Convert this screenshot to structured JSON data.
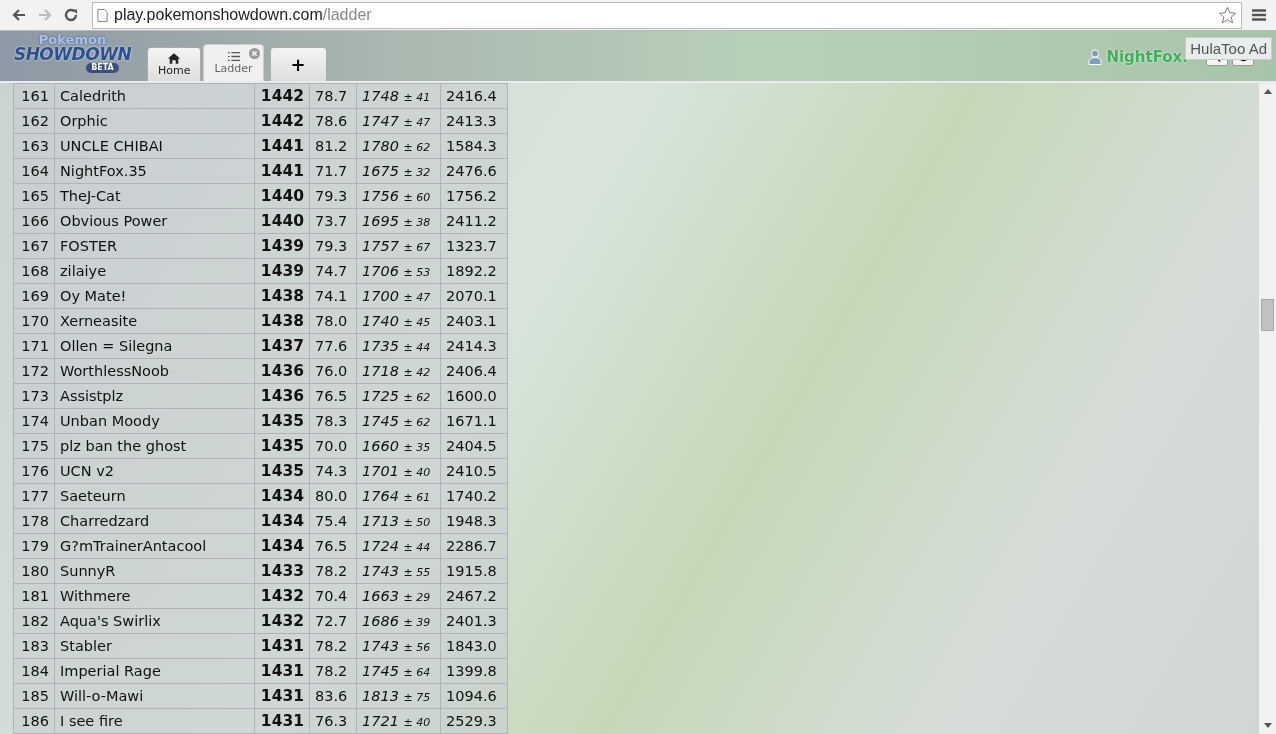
{
  "browser": {
    "url_host": "play.pokemonshowdown.com",
    "url_path": "/ladder"
  },
  "header": {
    "logo": {
      "top": "Pokémon",
      "main": "SHOWDOWN",
      "badge": "BETA"
    },
    "tabs": [
      {
        "kind": "home",
        "label": "Home",
        "selected": false,
        "closable": false
      },
      {
        "kind": "ladder",
        "label": "Ladder",
        "selected": true,
        "closable": true
      },
      {
        "kind": "new",
        "label": "+",
        "selected": false,
        "closable": false
      }
    ],
    "user": {
      "name": "NightFox."
    },
    "tooltip": "HulaToo Ad"
  },
  "ladder": {
    "rows": [
      {
        "rank": "161",
        "name": "Caledrith",
        "elo": "1442",
        "gxe": "78.7",
        "glicko": "1748",
        "deviation": "± 41",
        "coil": "2416.4"
      },
      {
        "rank": "162",
        "name": "Orphic",
        "elo": "1442",
        "gxe": "78.6",
        "glicko": "1747",
        "deviation": "± 47",
        "coil": "2413.3"
      },
      {
        "rank": "163",
        "name": "UNCLE CHIBAI",
        "elo": "1441",
        "gxe": "81.2",
        "glicko": "1780",
        "deviation": "± 62",
        "coil": "1584.3"
      },
      {
        "rank": "164",
        "name": "NightFox.35",
        "elo": "1441",
        "gxe": "71.7",
        "glicko": "1675",
        "deviation": "± 32",
        "coil": "2476.6"
      },
      {
        "rank": "165",
        "name": "TheJ-Cat",
        "elo": "1440",
        "gxe": "79.3",
        "glicko": "1756",
        "deviation": "± 60",
        "coil": "1756.2"
      },
      {
        "rank": "166",
        "name": "Obvious Power",
        "elo": "1440",
        "gxe": "73.7",
        "glicko": "1695",
        "deviation": "± 38",
        "coil": "2411.2"
      },
      {
        "rank": "167",
        "name": "FOSTER",
        "elo": "1439",
        "gxe": "79.3",
        "glicko": "1757",
        "deviation": "± 67",
        "coil": "1323.7"
      },
      {
        "rank": "168",
        "name": "zilaiye",
        "elo": "1439",
        "gxe": "74.7",
        "glicko": "1706",
        "deviation": "± 53",
        "coil": "1892.2"
      },
      {
        "rank": "169",
        "name": "Oy Mate!",
        "elo": "1438",
        "gxe": "74.1",
        "glicko": "1700",
        "deviation": "± 47",
        "coil": "2070.1"
      },
      {
        "rank": "170",
        "name": "Xerneasite",
        "elo": "1438",
        "gxe": "78.0",
        "glicko": "1740",
        "deviation": "± 45",
        "coil": "2403.1"
      },
      {
        "rank": "171",
        "name": "Ollen = Silegna",
        "elo": "1437",
        "gxe": "77.6",
        "glicko": "1735",
        "deviation": "± 44",
        "coil": "2414.3"
      },
      {
        "rank": "172",
        "name": "WorthlessNoob",
        "elo": "1436",
        "gxe": "76.0",
        "glicko": "1718",
        "deviation": "± 42",
        "coil": "2406.4"
      },
      {
        "rank": "173",
        "name": "Assistplz",
        "elo": "1436",
        "gxe": "76.5",
        "glicko": "1725",
        "deviation": "± 62",
        "coil": "1600.0"
      },
      {
        "rank": "174",
        "name": "Unban Moody",
        "elo": "1435",
        "gxe": "78.3",
        "glicko": "1745",
        "deviation": "± 62",
        "coil": "1671.1"
      },
      {
        "rank": "175",
        "name": "plz ban the ghost",
        "elo": "1435",
        "gxe": "70.0",
        "glicko": "1660",
        "deviation": "± 35",
        "coil": "2404.5"
      },
      {
        "rank": "176",
        "name": "UCN v2",
        "elo": "1435",
        "gxe": "74.3",
        "glicko": "1701",
        "deviation": "± 40",
        "coil": "2410.5"
      },
      {
        "rank": "177",
        "name": "Saeteurn",
        "elo": "1434",
        "gxe": "80.0",
        "glicko": "1764",
        "deviation": "± 61",
        "coil": "1740.2"
      },
      {
        "rank": "178",
        "name": "Charredzard",
        "elo": "1434",
        "gxe": "75.4",
        "glicko": "1713",
        "deviation": "± 50",
        "coil": "1948.3"
      },
      {
        "rank": "179",
        "name": "G?mTrainerAntacool",
        "elo": "1434",
        "gxe": "76.5",
        "glicko": "1724",
        "deviation": "± 44",
        "coil": "2286.7"
      },
      {
        "rank": "180",
        "name": "SunnyR",
        "elo": "1433",
        "gxe": "78.2",
        "glicko": "1743",
        "deviation": "± 55",
        "coil": "1915.8"
      },
      {
        "rank": "181",
        "name": "Withmere",
        "elo": "1432",
        "gxe": "70.4",
        "glicko": "1663",
        "deviation": "± 29",
        "coil": "2467.2"
      },
      {
        "rank": "182",
        "name": "Aqua's Swirlix",
        "elo": "1432",
        "gxe": "72.7",
        "glicko": "1686",
        "deviation": "± 39",
        "coil": "2401.3"
      },
      {
        "rank": "183",
        "name": "Stabler",
        "elo": "1431",
        "gxe": "78.2",
        "glicko": "1743",
        "deviation": "± 56",
        "coil": "1843.0"
      },
      {
        "rank": "184",
        "name": "Imperial Rage",
        "elo": "1431",
        "gxe": "78.2",
        "glicko": "1745",
        "deviation": "± 64",
        "coil": "1399.8"
      },
      {
        "rank": "185",
        "name": "Will-o-Mawi",
        "elo": "1431",
        "gxe": "83.6",
        "glicko": "1813",
        "deviation": "± 75",
        "coil": "1094.6"
      },
      {
        "rank": "186",
        "name": "I see fire",
        "elo": "1431",
        "gxe": "76.3",
        "glicko": "1721",
        "deviation": "± 40",
        "coil": "2529.3"
      }
    ]
  }
}
